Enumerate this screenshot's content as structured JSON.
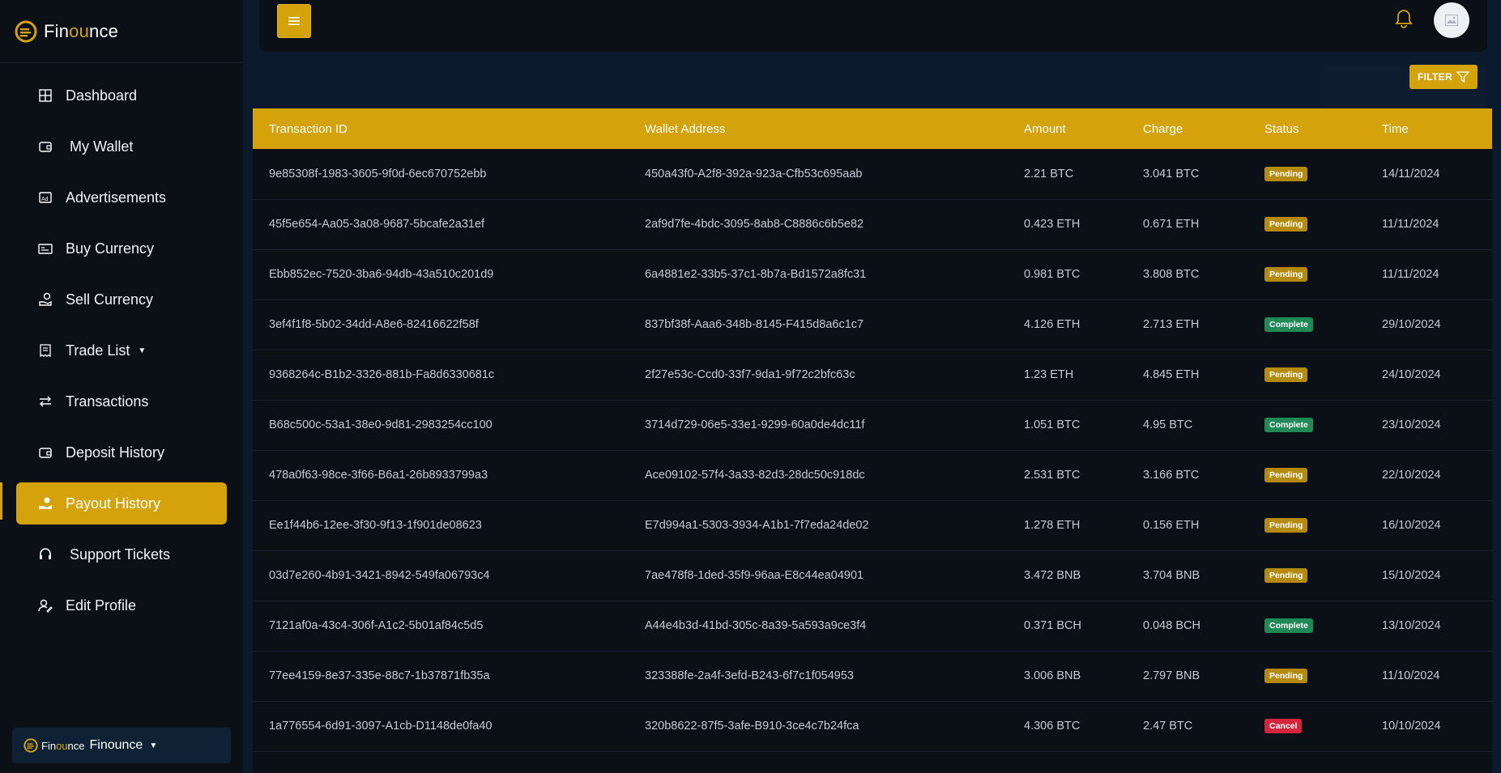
{
  "brand": {
    "prefix": "Fin",
    "highlight": "ou",
    "suffix": "nce"
  },
  "sidebar": {
    "items": [
      {
        "label": "Dashboard",
        "icon": "grid-icon"
      },
      {
        "label": "My Wallet",
        "icon": "wallet-icon"
      },
      {
        "label": "Advertisements",
        "icon": "ad-icon"
      },
      {
        "label": "Buy Currency",
        "icon": "card-icon"
      },
      {
        "label": "Sell Currency",
        "icon": "hand-coin-icon"
      },
      {
        "label": "Trade List",
        "icon": "receipt-icon"
      },
      {
        "label": "Transactions",
        "icon": "transfer-icon"
      },
      {
        "label": "Deposit History",
        "icon": "wallet-icon"
      },
      {
        "label": "Payout History",
        "icon": "payout-icon"
      },
      {
        "label": "Support Tickets",
        "icon": "headset-icon"
      },
      {
        "label": "Edit Profile",
        "icon": "user-edit-icon"
      }
    ],
    "active": "Payout History"
  },
  "workspace": {
    "small_prefix": "Fin",
    "small_highlight": "ou",
    "small_suffix": "nce",
    "name": "Finounce"
  },
  "filter": {
    "label": "FILTER"
  },
  "colors": {
    "accent": "#d4a20a",
    "pending": "#b58b0f",
    "complete": "#1f8a56",
    "cancel": "#d6243c"
  },
  "table": {
    "headers": [
      "Transaction ID",
      "Wallet Address",
      "Amount",
      "Charge",
      "Status",
      "Time"
    ],
    "rows": [
      [
        "9e85308f-1983-3605-9f0d-6ec670752ebb",
        "450a43f0-A2f8-392a-923a-Cfb53c695aab",
        "2.21 BTC",
        "3.041 BTC",
        "Pending",
        "14/11/2024"
      ],
      [
        "45f5e654-Aa05-3a08-9687-5bcafe2a31ef",
        "2af9d7fe-4bdc-3095-8ab8-C8886c6b5e82",
        "0.423 ETH",
        "0.671 ETH",
        "Pending",
        "11/11/2024"
      ],
      [
        "Ebb852ec-7520-3ba6-94db-43a510c201d9",
        "6a4881e2-33b5-37c1-8b7a-Bd1572a8fc31",
        "0.981 BTC",
        "3.808 BTC",
        "Pending",
        "11/11/2024"
      ],
      [
        "3ef4f1f8-5b02-34dd-A8e6-82416622f58f",
        "837bf38f-Aaa6-348b-8145-F415d8a6c1c7",
        "4.126 ETH",
        "2.713 ETH",
        "Complete",
        "29/10/2024"
      ],
      [
        "9368264c-B1b2-3326-881b-Fa8d6330681c",
        "2f27e53c-Ccd0-33f7-9da1-9f72c2bfc63c",
        "1.23 ETH",
        "4.845 ETH",
        "Pending",
        "24/10/2024"
      ],
      [
        "B68c500c-53a1-38e0-9d81-2983254cc100",
        "3714d729-06e5-33e1-9299-60a0de4dc11f",
        "1.051 BTC",
        "4.95 BTC",
        "Complete",
        "23/10/2024"
      ],
      [
        "478a0f63-98ce-3f66-B6a1-26b8933799a3",
        "Ace09102-57f4-3a33-82d3-28dc50c918dc",
        "2.531 BTC",
        "3.166 BTC",
        "Pending",
        "22/10/2024"
      ],
      [
        "Ee1f44b6-12ee-3f30-9f13-1f901de08623",
        "E7d994a1-5303-3934-A1b1-7f7eda24de02",
        "1.278 ETH",
        "0.156 ETH",
        "Pending",
        "16/10/2024"
      ],
      [
        "03d7e260-4b91-3421-8942-549fa06793c4",
        "7ae478f8-1ded-35f9-96aa-E8c44ea04901",
        "3.472 BNB",
        "3.704 BNB",
        "Pending",
        "15/10/2024"
      ],
      [
        "7121af0a-43c4-306f-A1c2-5b01af84c5d5",
        "A44e4b3d-41bd-305c-8a39-5a593a9ce3f4",
        "0.371 BCH",
        "0.048 BCH",
        "Complete",
        "13/10/2024"
      ],
      [
        "77ee4159-8e37-335e-88c7-1b37871fb35a",
        "323388fe-2a4f-3efd-B243-6f7c1f054953",
        "3.006 BNB",
        "2.797 BNB",
        "Pending",
        "11/10/2024"
      ],
      [
        "1a776554-6d91-3097-A1cb-D1148de0fa40",
        "320b8622-87f5-3afe-B910-3ce4c7b24fca",
        "4.306 BTC",
        "2.47 BTC",
        "Cancel",
        "10/10/2024"
      ]
    ]
  }
}
